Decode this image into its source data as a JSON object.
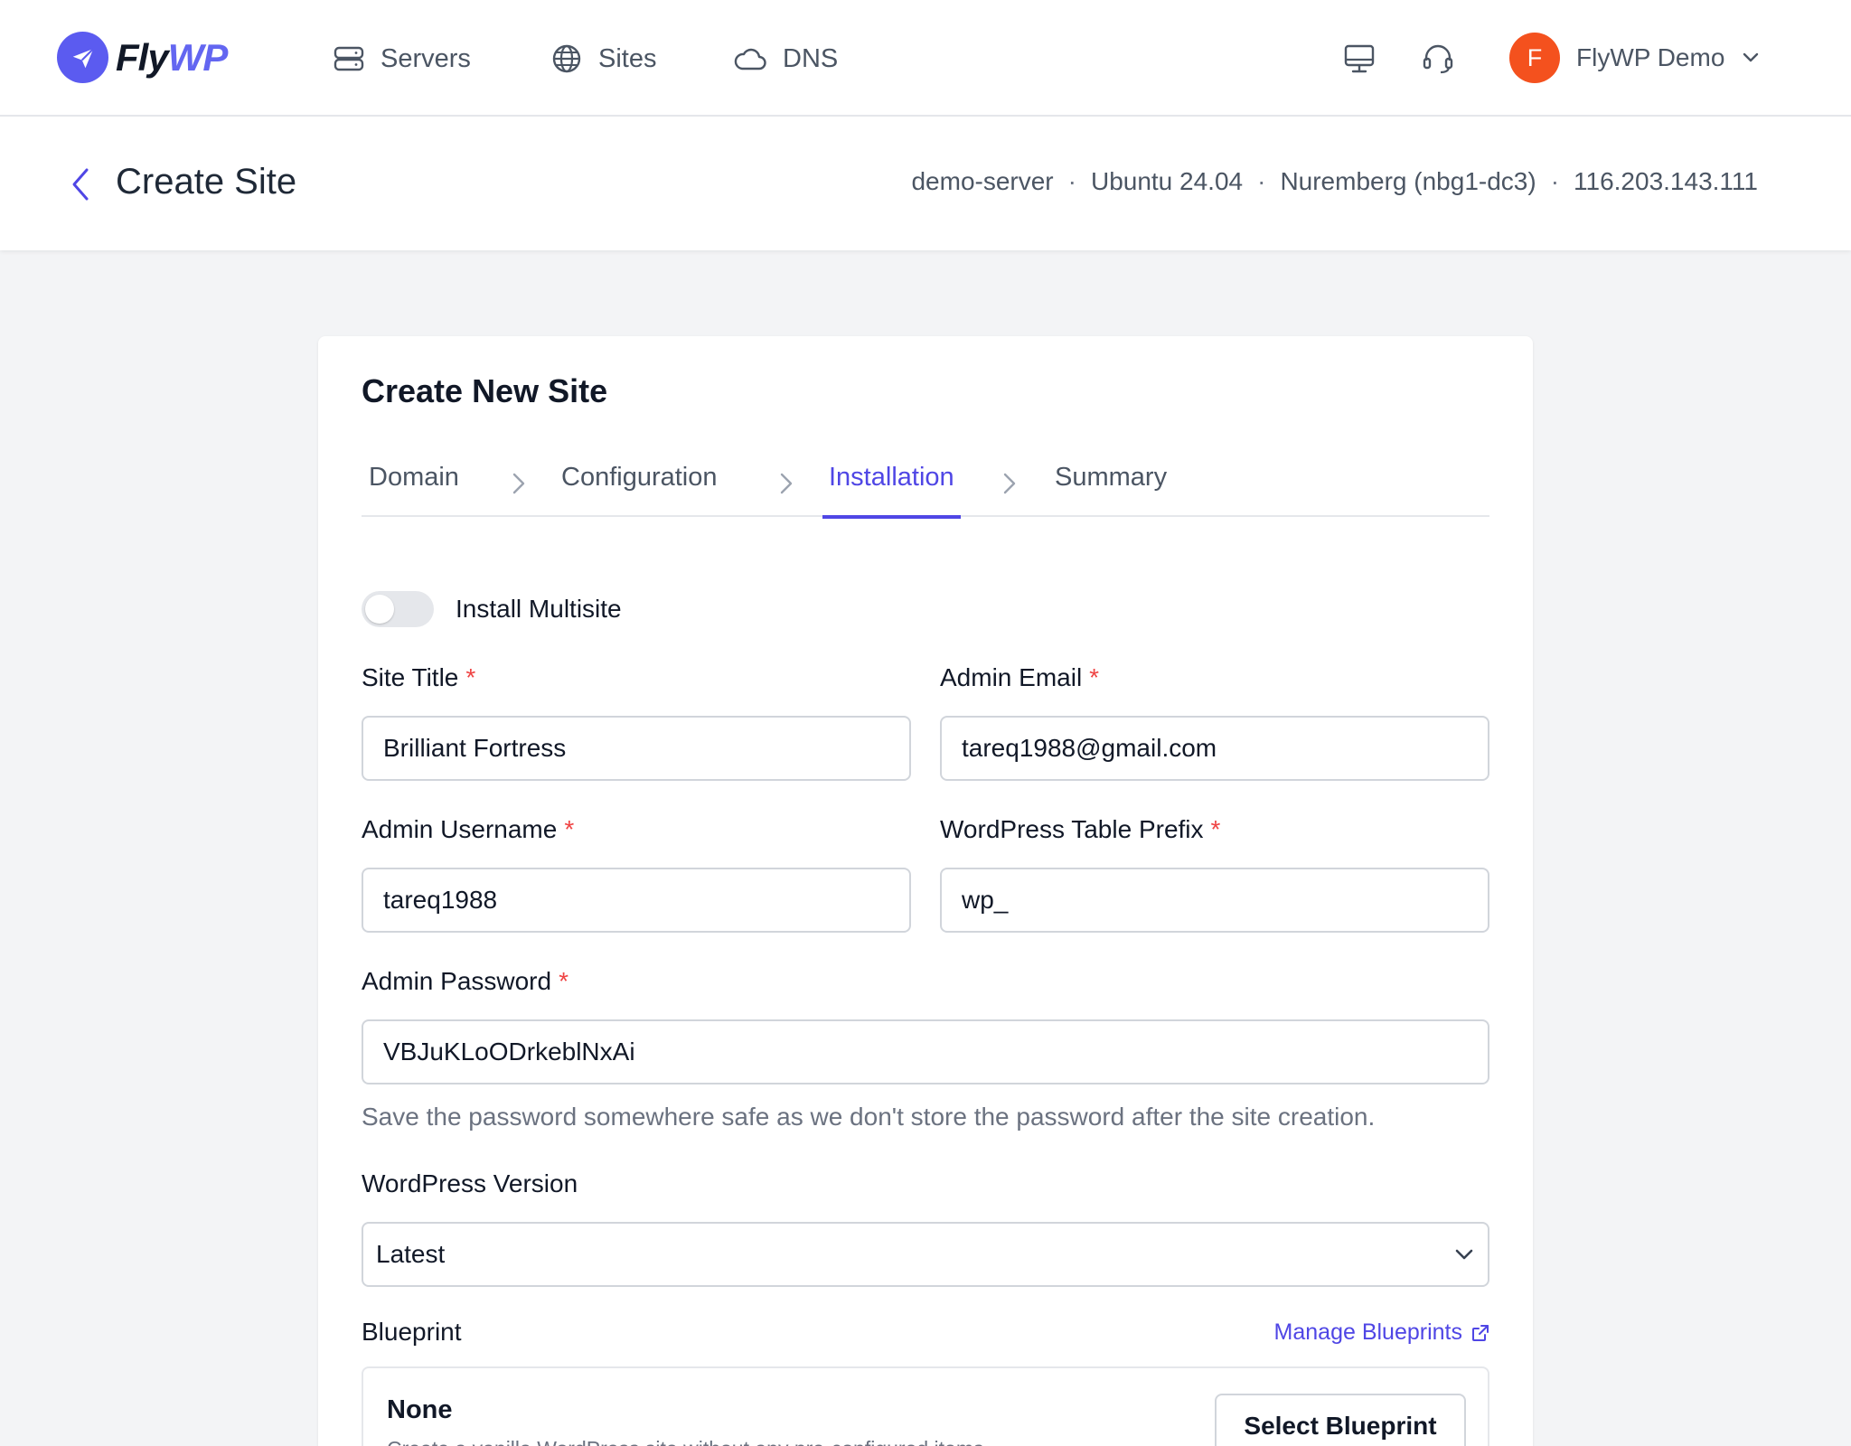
{
  "brand": {
    "name_part1": "Fly",
    "name_part2": "WP",
    "accent": "#6366f1"
  },
  "topnav": {
    "items": [
      {
        "label": "Servers",
        "icon": "server-icon"
      },
      {
        "label": "Sites",
        "icon": "globe-icon"
      },
      {
        "label": "DNS",
        "icon": "cloud-icon"
      }
    ],
    "icons": [
      "monitor-icon",
      "headset-icon"
    ],
    "user": {
      "initial": "F",
      "name": "FlyWP Demo",
      "avatar_color": "#f4511e"
    }
  },
  "page": {
    "title": "Create Site",
    "server": {
      "name": "demo-server",
      "os": "Ubuntu 24.04",
      "location": "Nuremberg (nbg1-dc3)",
      "ip": "116.203.143.111",
      "separator": "·"
    }
  },
  "form": {
    "title": "Create New Site",
    "steps": [
      {
        "label": "Domain",
        "active": false
      },
      {
        "label": "Configuration",
        "active": false
      },
      {
        "label": "Installation",
        "active": true
      },
      {
        "label": "Summary",
        "active": false
      }
    ],
    "multisite": {
      "label": "Install Multisite",
      "enabled": false
    },
    "required_mark": "*",
    "site_title": {
      "label": "Site Title",
      "value": "Brilliant Fortress"
    },
    "admin_email": {
      "label": "Admin Email",
      "value": "tareq1988@gmail.com"
    },
    "admin_username": {
      "label": "Admin Username",
      "value": "tareq1988"
    },
    "table_prefix": {
      "label": "WordPress Table Prefix",
      "value": "wp_"
    },
    "admin_password": {
      "label": "Admin Password",
      "value": "VBJuKLoODrkeblNxAi",
      "help": "Save the password somewhere safe as we don't store the password after the site creation."
    },
    "wp_version": {
      "label": "WordPress Version",
      "selected": "Latest"
    },
    "blueprint": {
      "label": "Blueprint",
      "manage_link": "Manage Blueprints",
      "selected_name": "None",
      "selected_desc": "Create a vanilla WordPress site without any pre-configured items.",
      "button": "Select Blueprint"
    }
  }
}
